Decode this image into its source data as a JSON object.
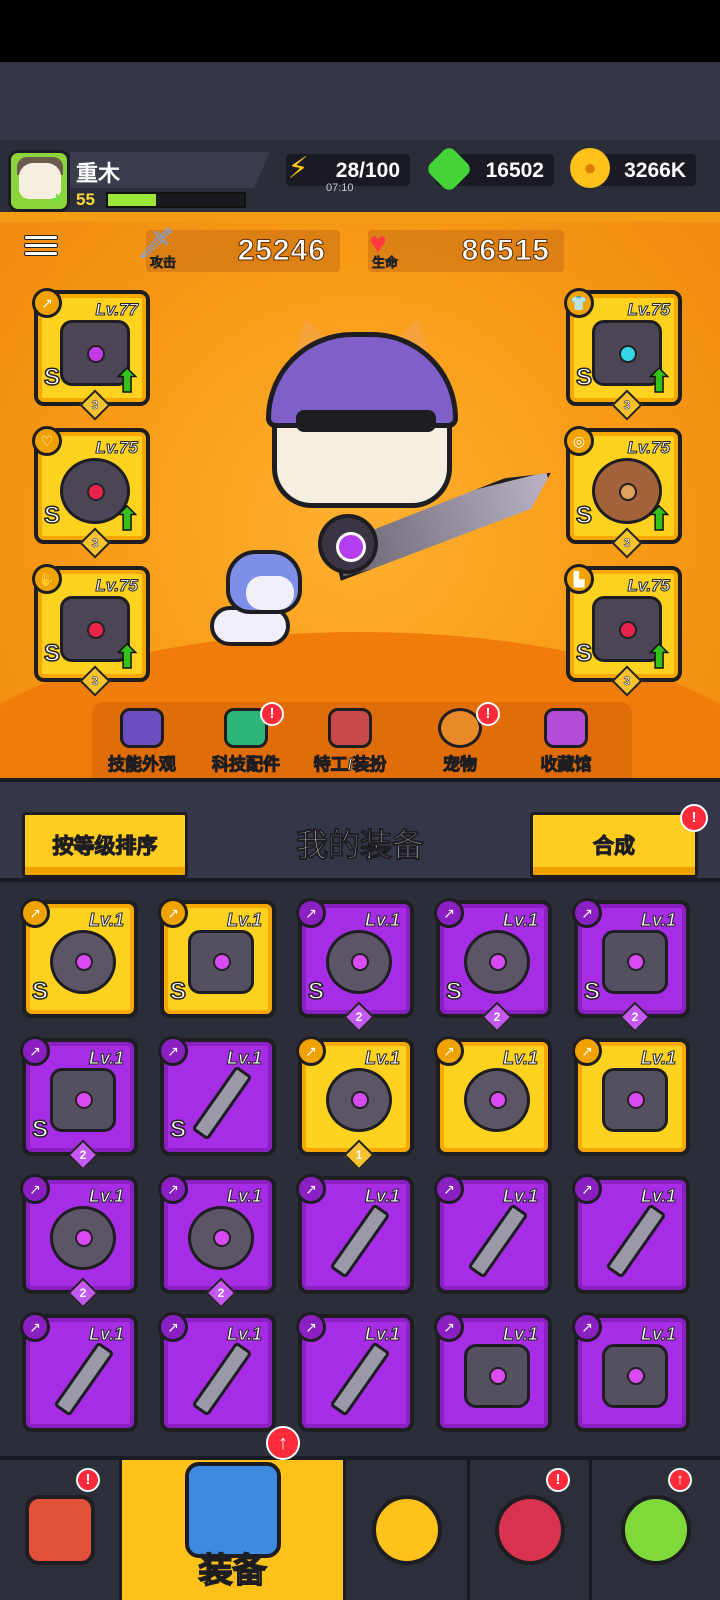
{
  "player": {
    "name": "重木",
    "level": "55",
    "xp_fraction": 0.35
  },
  "resources": {
    "energy": {
      "value": "28/100",
      "timer": "07:10",
      "icon": "lightning-icon"
    },
    "gems": {
      "value": "16502",
      "icon": "green-gem-icon"
    },
    "gold": {
      "value": "3266K",
      "icon": "gold-coin-icon"
    }
  },
  "stats": {
    "attack": {
      "label": "攻击",
      "value": "25246",
      "icon": "sword-icon"
    },
    "health": {
      "label": "生命",
      "value": "86515",
      "icon": "heart-icon"
    }
  },
  "equipped_left": [
    {
      "level": "Lv.77",
      "rank": "S",
      "stars": "3",
      "slot_icon": "weapon-icon"
    },
    {
      "level": "Lv.75",
      "rank": "S",
      "stars": "3",
      "slot_icon": "necklace-icon"
    },
    {
      "level": "Lv.75",
      "rank": "S",
      "stars": "3",
      "slot_icon": "glove-icon"
    }
  ],
  "equipped_right": [
    {
      "level": "Lv.75",
      "rank": "S",
      "stars": "3",
      "slot_icon": "armor-icon"
    },
    {
      "level": "Lv.75",
      "rank": "S",
      "stars": "3",
      "slot_icon": "belt-icon"
    },
    {
      "level": "Lv.75",
      "rank": "S",
      "stars": "3",
      "slot_icon": "boot-icon"
    }
  ],
  "hero_tabs": [
    {
      "label": "技能外观",
      "badge": ""
    },
    {
      "label": "科技配件",
      "badge": "!"
    },
    {
      "label": "特工/装扮",
      "badge": ""
    },
    {
      "label": "宠物",
      "badge": "!"
    },
    {
      "label": "收藏馆",
      "badge": ""
    }
  ],
  "inventory": {
    "sort_label": "按等级排序",
    "title": "我的装备",
    "merge_label": "合成",
    "merge_badge": "!",
    "items": [
      {
        "level": "Lv.1",
        "rank": "S",
        "stars": "",
        "color": "gold"
      },
      {
        "level": "Lv.1",
        "rank": "S",
        "stars": "",
        "color": "gold"
      },
      {
        "level": "Lv.1",
        "rank": "S",
        "stars": "2",
        "color": "purple"
      },
      {
        "level": "Lv.1",
        "rank": "S",
        "stars": "2",
        "color": "purple"
      },
      {
        "level": "Lv.1",
        "rank": "S",
        "stars": "2",
        "color": "purple"
      },
      {
        "level": "Lv.1",
        "rank": "S",
        "stars": "2",
        "color": "purple"
      },
      {
        "level": "Lv.1",
        "rank": "S",
        "stars": "",
        "color": "purple"
      },
      {
        "level": "Lv.1",
        "rank": "",
        "stars": "1",
        "color": "gold"
      },
      {
        "level": "Lv.1",
        "rank": "",
        "stars": "",
        "color": "gold"
      },
      {
        "level": "Lv.1",
        "rank": "",
        "stars": "",
        "color": "gold"
      },
      {
        "level": "Lv.1",
        "rank": "",
        "stars": "2",
        "color": "purple"
      },
      {
        "level": "Lv.1",
        "rank": "",
        "stars": "2",
        "color": "purple"
      },
      {
        "level": "Lv.1",
        "rank": "",
        "stars": "",
        "color": "purple"
      },
      {
        "level": "Lv.1",
        "rank": "",
        "stars": "",
        "color": "purple"
      },
      {
        "level": "Lv.1",
        "rank": "",
        "stars": "",
        "color": "purple"
      },
      {
        "level": "Lv.1",
        "rank": "",
        "stars": "",
        "color": "purple"
      },
      {
        "level": "Lv.1",
        "rank": "",
        "stars": "",
        "color": "purple"
      },
      {
        "level": "Lv.1",
        "rank": "",
        "stars": "",
        "color": "purple"
      },
      {
        "level": "Lv.1",
        "rank": "",
        "stars": "",
        "color": "purple"
      },
      {
        "level": "Lv.1",
        "rank": "",
        "stars": "",
        "color": "purple"
      }
    ]
  },
  "nav": {
    "equipment_label": "装备",
    "shop_badge": "!",
    "equipment_badge": "↑",
    "map_badge": "!",
    "lab_badge": "↑"
  },
  "colors": {
    "accent_orange": "#f89b16",
    "rare_gold": "#ffd21f",
    "epic_purple": "#a72ce6"
  }
}
